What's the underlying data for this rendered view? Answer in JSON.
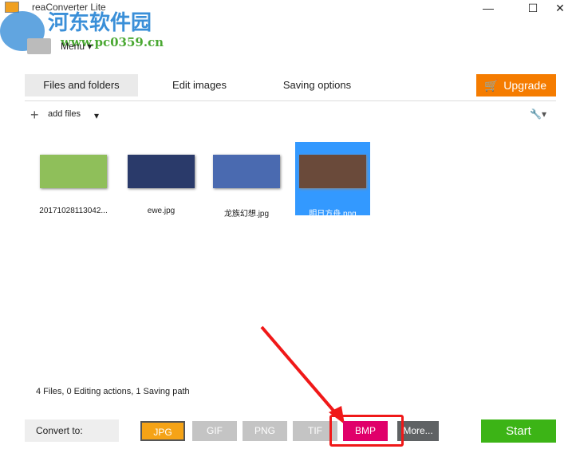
{
  "window": {
    "title": "reaConverter Lite",
    "minimize": "—",
    "maximize": "☐",
    "close": "✕"
  },
  "watermark": {
    "line1": "河东软件园",
    "line2": "www.pc0359.cn"
  },
  "menu": {
    "label": "Menu ▾"
  },
  "tabs": [
    {
      "label": "Files and folders"
    },
    {
      "label": "Edit images"
    },
    {
      "label": "Saving options"
    }
  ],
  "upgrade": {
    "label": "Upgrade",
    "icon": "🛒"
  },
  "toolbar": {
    "add_files": "add files",
    "plus": "+",
    "caret": "▾",
    "wrench": "🔧▾"
  },
  "files": [
    {
      "name": "20171028113042...",
      "color": "#8fbf5a"
    },
    {
      "name": "ewe.jpg",
      "color": "#2a3a6a"
    },
    {
      "name": "龙族幻想.jpg",
      "color": "#4a6ab0"
    },
    {
      "name": "明日方舟.png",
      "color": "#6a4a3a"
    }
  ],
  "status": "4 Files, 0 Editing actions, 1 Saving path",
  "convert": {
    "label": "Convert to:",
    "formats": [
      {
        "label": "JPG",
        "color": "#f5a316"
      },
      {
        "label": "GIF",
        "color": "#c4c4c4"
      },
      {
        "label": "PNG",
        "color": "#c4c4c4"
      },
      {
        "label": "TIF",
        "color": "#c4c4c4"
      },
      {
        "label": "BMP",
        "color": "#e0006a"
      },
      {
        "label": "More...",
        "color": "#5f6264"
      }
    ],
    "start": "Start"
  }
}
